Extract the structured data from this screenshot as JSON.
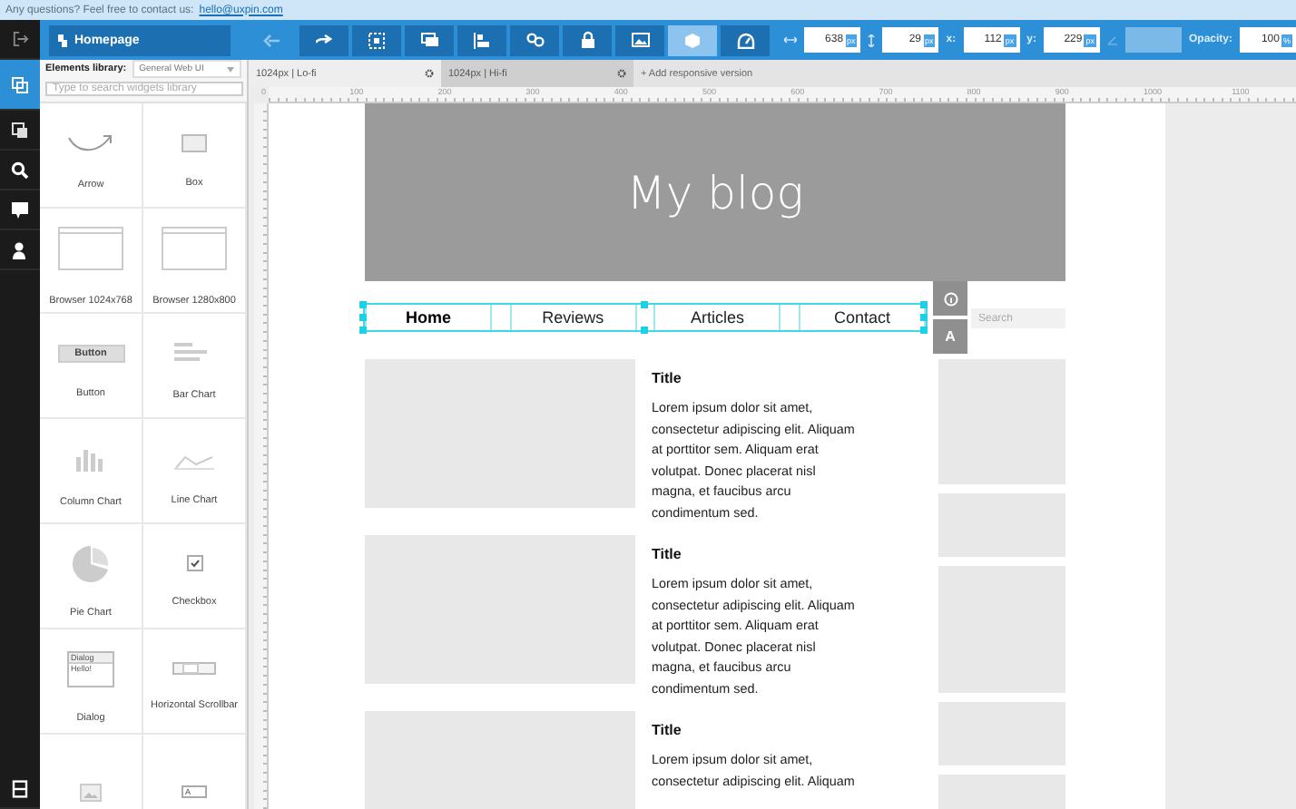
{
  "banner": {
    "text": "Any questions? Feel free to contact us:",
    "link": "hello@uxpin.com"
  },
  "rail": {
    "top": [
      {
        "kind": "exit",
        "selected": false
      }
    ],
    "items": [
      {
        "kind": "elements",
        "selected": true
      },
      {
        "kind": "copies",
        "selected": false
      },
      {
        "kind": "search",
        "selected": false
      },
      {
        "kind": "comments",
        "selected": false
      },
      {
        "kind": "user",
        "selected": false
      }
    ],
    "bottom": [
      {
        "kind": "layers",
        "selected": false
      }
    ]
  },
  "toolbar": {
    "page_button": "Homepage",
    "tools": [
      {
        "kind": "undo",
        "disabled": true,
        "selected": false
      },
      {
        "kind": "redo",
        "disabled": false,
        "selected": false
      },
      {
        "kind": "group",
        "disabled": false,
        "selected": false
      },
      {
        "kind": "duplicate",
        "disabled": false,
        "selected": false
      },
      {
        "kind": "align",
        "disabled": false,
        "selected": false
      },
      {
        "kind": "link",
        "disabled": false,
        "selected": false
      },
      {
        "kind": "lock",
        "disabled": false,
        "selected": false
      },
      {
        "kind": "image",
        "disabled": false,
        "selected": false
      },
      {
        "kind": "cube",
        "disabled": false,
        "selected": true
      },
      {
        "kind": "gauge",
        "disabled": false,
        "selected": false
      }
    ],
    "fields": [
      {
        "kind": "width",
        "value": "638",
        "unit": "px",
        "disabled": false
      },
      {
        "kind": "height",
        "value": "29",
        "unit": "px",
        "disabled": false
      },
      {
        "kind": "label",
        "label": "x:",
        "value": "112",
        "unit": "px",
        "disabled": false
      },
      {
        "kind": "label",
        "label": "y:",
        "value": "229",
        "unit": "px",
        "disabled": false
      },
      {
        "kind": "rotation",
        "disabled": true
      },
      {
        "kind": "label",
        "label": "Opacity:",
        "value": "100",
        "unit": "%",
        "disabled": false
      }
    ]
  },
  "library": {
    "label": "Elements library:",
    "dropdown": "General Web UI",
    "search": {
      "placeholder": "Type to search widgets library"
    },
    "widgets": [
      {
        "kind": "arrow",
        "label": "Arrow"
      },
      {
        "kind": "box",
        "label": "Box"
      },
      {
        "kind": "browser",
        "label": "Browser 1024x768"
      },
      {
        "kind": "browser",
        "label": "Browser 1280x800"
      },
      {
        "kind": "button",
        "label": "Button",
        "preview": "Button"
      },
      {
        "kind": "bar_chart",
        "label": "Bar Chart"
      },
      {
        "kind": "column_chart",
        "label": "Column Chart"
      },
      {
        "kind": "line_chart",
        "label": "Line Chart"
      },
      {
        "kind": "pie_chart",
        "label": "Pie Chart"
      },
      {
        "kind": "checkbox",
        "label": "Checkbox"
      },
      {
        "kind": "dialog",
        "label": "Dialog",
        "preview": "Dialog",
        "preview_body": "Hello!"
      },
      {
        "kind": "scrollbar",
        "label": "Horizontal Scrollbar"
      },
      {
        "kind": "image"
      },
      {
        "kind": "textfield",
        "preview": "A"
      }
    ]
  },
  "tabs": [
    {
      "label": "1024px | Lo-fi",
      "selected": true
    },
    {
      "label": "1024px | Hi-fi",
      "selected": false
    }
  ],
  "add_version": "+ Add responsive version",
  "ruler_labels": [
    "0",
    "100",
    "200",
    "300",
    "400",
    "500",
    "600",
    "700",
    "800",
    "900",
    "1000",
    "1100"
  ],
  "canvas": {
    "header_title": "My blog",
    "nav": {
      "selected": true,
      "items": [
        {
          "label": "Home",
          "selected": true
        },
        {
          "label": "Reviews",
          "selected": false
        },
        {
          "label": "Articles",
          "selected": false
        },
        {
          "label": "Contact",
          "selected": false
        }
      ]
    },
    "side_buttons": [
      {
        "kind": "info"
      },
      {
        "kind": "text",
        "label": "A"
      }
    ],
    "search": {
      "placeholder": "Search"
    },
    "articles": [
      {
        "title": "Title",
        "body": "Lorem ipsum dolor sit amet, consectetur adipiscing elit. Aliquam at porttitor sem. Aliquam erat volutpat. Donec placerat nisl magna, et faucibus arcu condimentum sed."
      },
      {
        "title": "Title",
        "body": "Lorem ipsum dolor sit amet, consectetur adipiscing elit. Aliquam at porttitor sem. Aliquam erat volutpat. Donec placerat nisl magna, et faucibus arcu condimentum sed."
      },
      {
        "title": "Title",
        "body": "Lorem ipsum dolor sit amet, consectetur adipiscing elit. Aliquam"
      }
    ]
  }
}
